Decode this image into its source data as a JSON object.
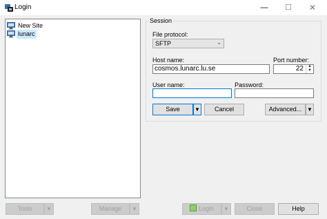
{
  "window": {
    "title": "Login",
    "minimize": "—",
    "maximize": "☐",
    "close": "✕"
  },
  "tree": {
    "items": [
      {
        "label": "New Site"
      },
      {
        "label": "lunarc"
      }
    ]
  },
  "session": {
    "legend": "Session",
    "file_protocol_label": "File protocol:",
    "file_protocol_value": "SFTP",
    "host_label": "Host name:",
    "host_value": "cosmos.lunarc.lu.se",
    "port_label": "Port number:",
    "port_value": "22",
    "user_label": "User name:",
    "user_value": "",
    "password_label": "Password:",
    "password_value": "",
    "save_label": "Save",
    "cancel_label": "Cancel",
    "advanced_label": "Advanced..."
  },
  "footer": {
    "tools_label": "Tools",
    "manage_label": "Manage",
    "login_label": "Login",
    "close_label": "Close",
    "help_label": "Help"
  },
  "icons": {
    "app": "winscp-icon",
    "site": "computer-monitor-icon",
    "dropdown": "chevron-down-icon",
    "login": "login-icon"
  }
}
